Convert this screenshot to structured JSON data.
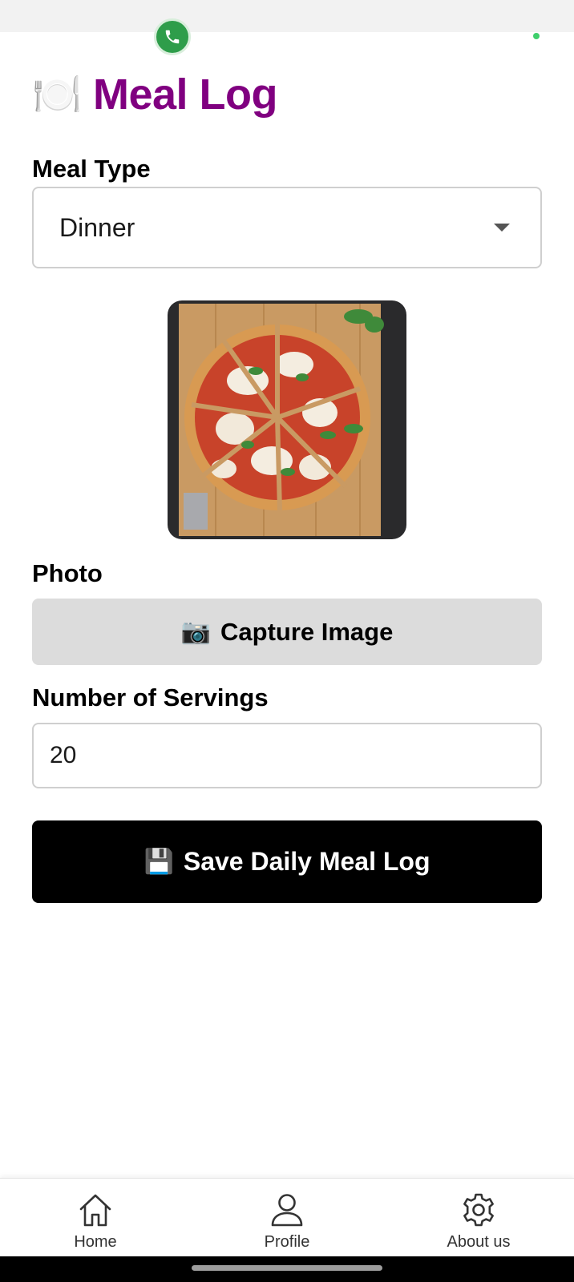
{
  "header": {
    "icon": "🍽️",
    "icon_name": "plate-cutlery-icon",
    "title": "Meal Log",
    "title_color": "#800080"
  },
  "form": {
    "meal_type_label": "Meal Type",
    "meal_type_value": "Dinner",
    "photo_label": "Photo",
    "photo_subject": "pizza-photo",
    "capture_button": {
      "icon": "📷",
      "label": "Capture Image"
    },
    "servings_label": "Number of Servings",
    "servings_value": "20",
    "save_button": {
      "icon": "💾",
      "label": "Save Daily Meal Log"
    }
  },
  "bottom_nav": {
    "items": [
      {
        "label": "Home",
        "icon": "home-icon"
      },
      {
        "label": "Profile",
        "icon": "person-icon"
      },
      {
        "label": "About us",
        "icon": "gear-icon"
      }
    ]
  },
  "colors": {
    "primary_button": "#000000",
    "secondary_button": "#dcdcdc",
    "call_bubble": "#2e9d4a"
  }
}
